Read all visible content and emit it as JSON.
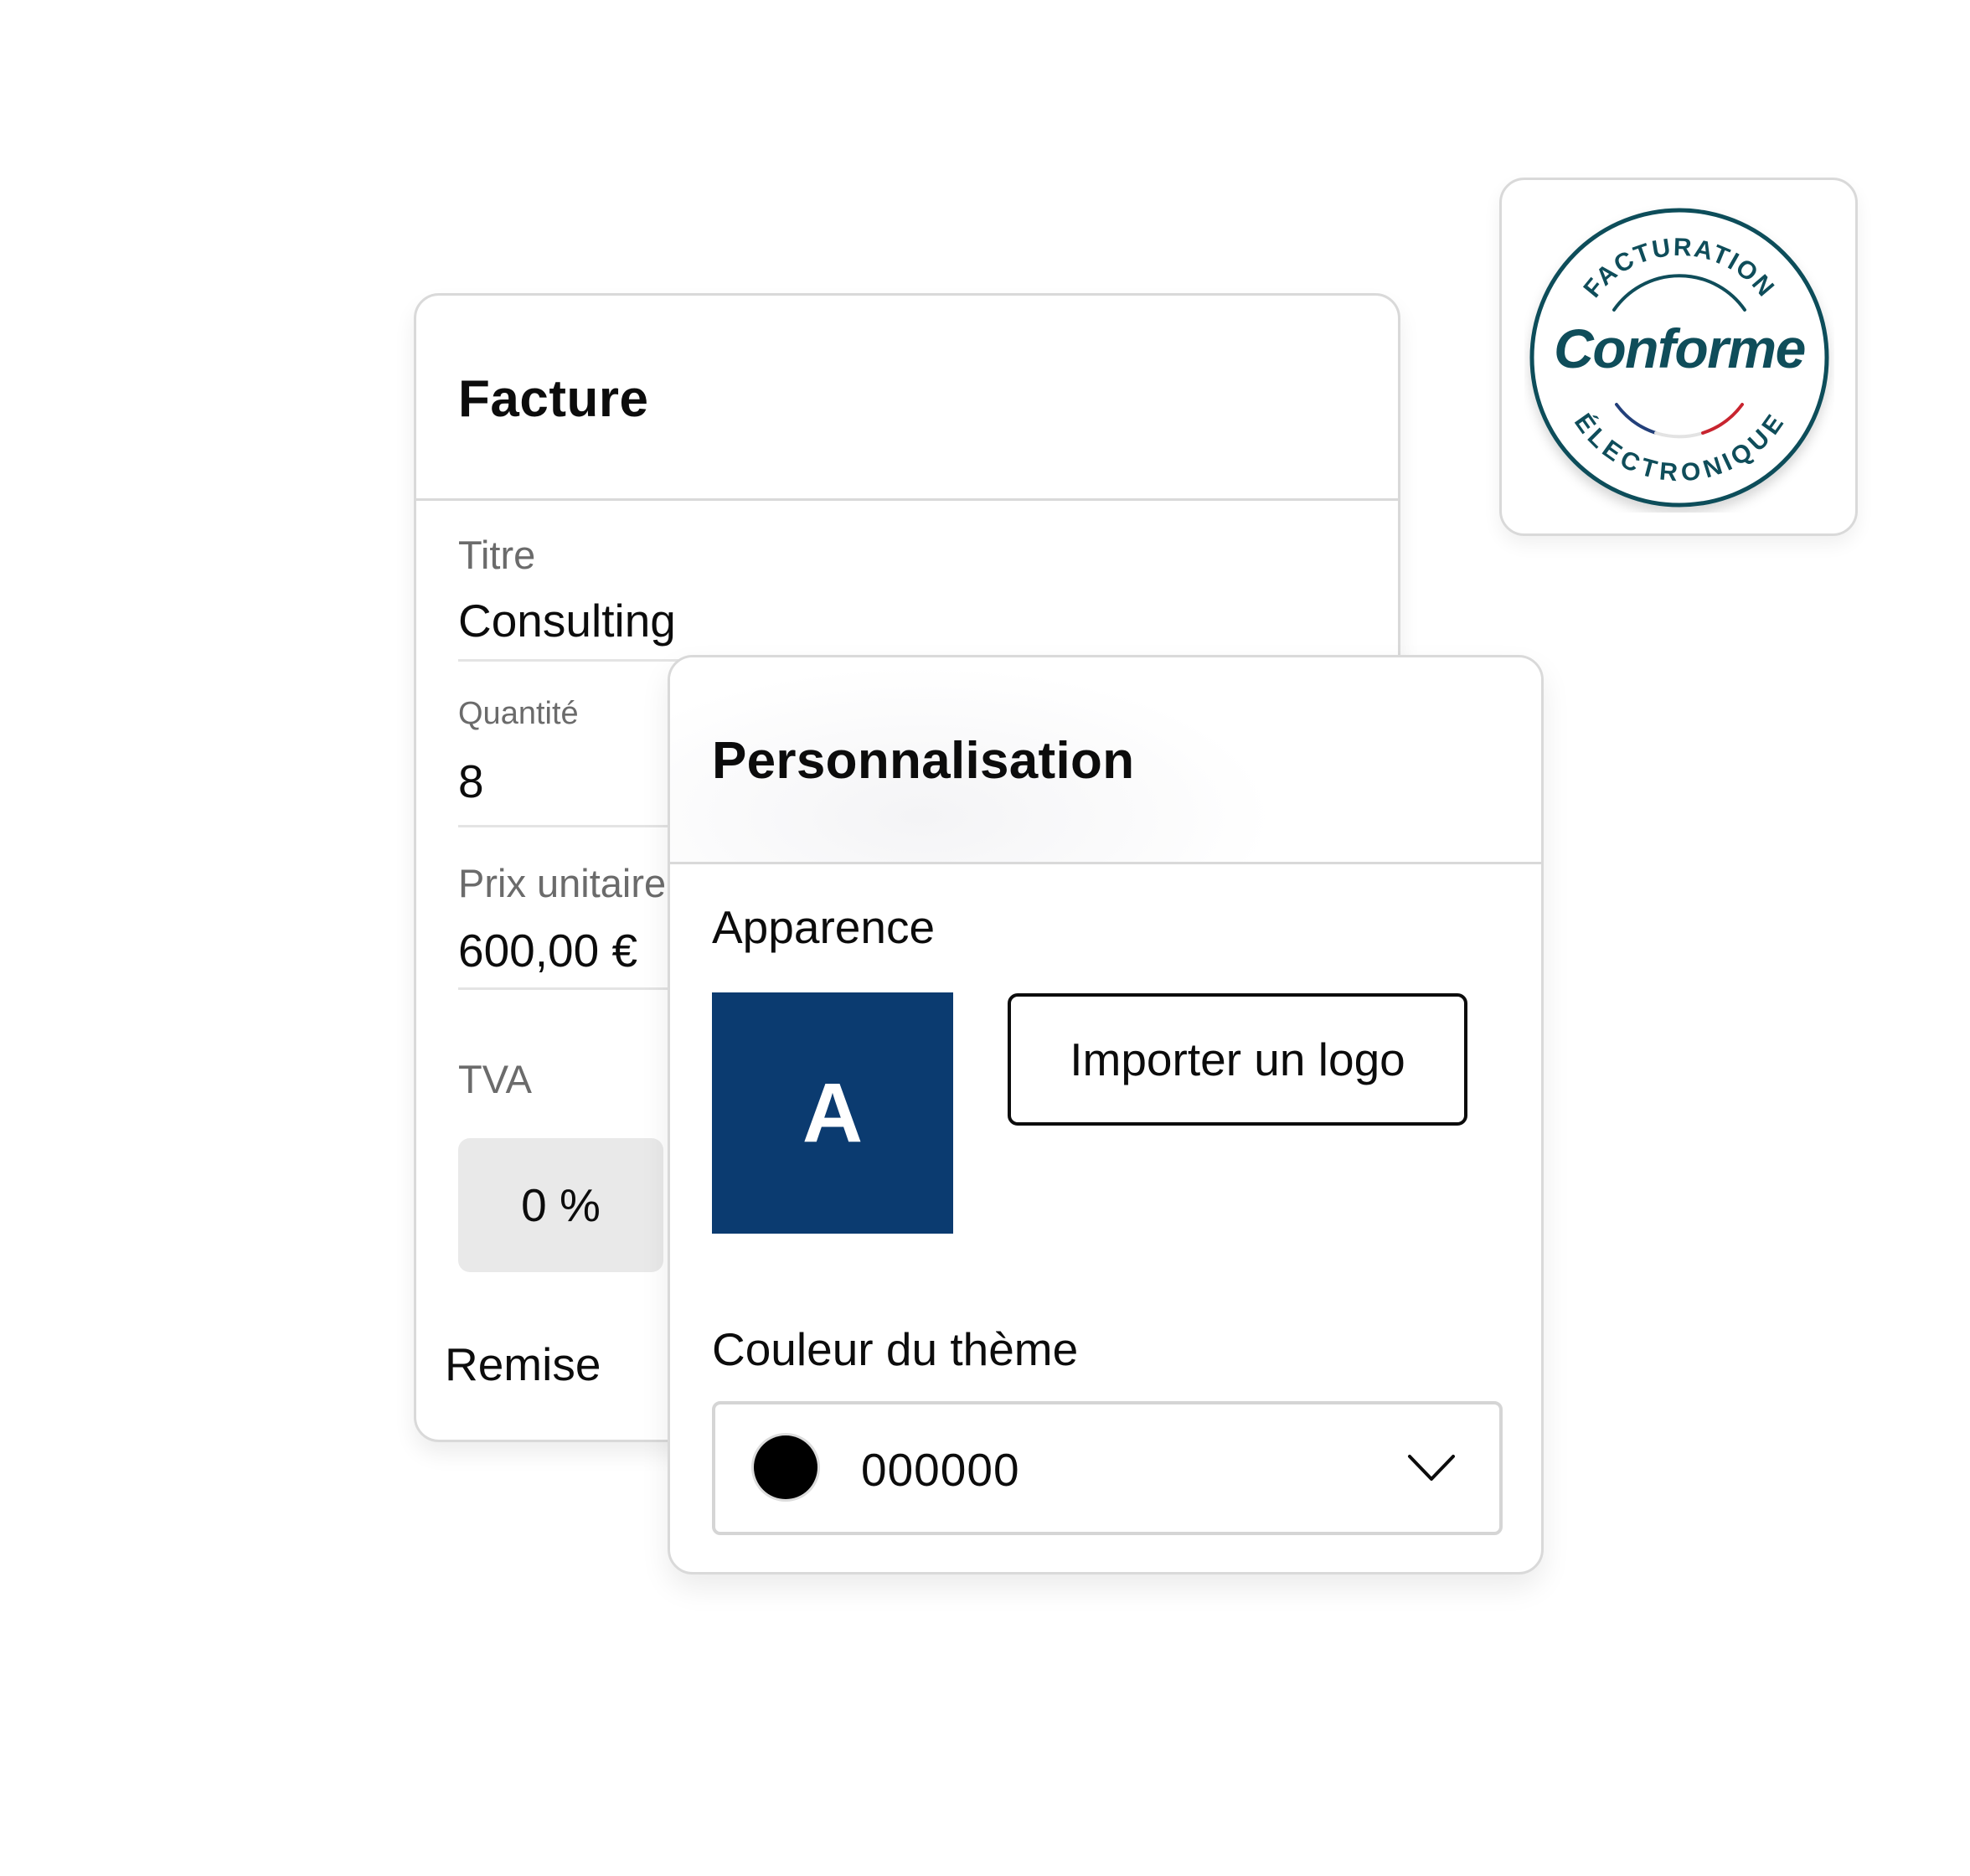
{
  "invoice": {
    "title": "Facture",
    "fields": [
      {
        "label": "Titre",
        "value": "Consulting"
      },
      {
        "label": "Quantité",
        "value": "8"
      },
      {
        "label": "Prix unitaire",
        "value": "600,00 €"
      }
    ],
    "vat": {
      "label": "TVA",
      "value": "0 %"
    },
    "discount_label": "Remise"
  },
  "customization": {
    "title": "Personnalisation",
    "appearance_label": "Apparence",
    "logo_letter": "A",
    "import_logo_label": "Importer un logo",
    "theme_color_label": "Couleur du thème",
    "theme_color_value": "000000",
    "theme_color_swatch": "#000000",
    "select_icon": "chevron-down-icon"
  },
  "badge": {
    "top_text": "FACTURATION",
    "main_text": "Conforme",
    "bottom_text": "ÉLECTRONIQUE",
    "colors": {
      "primary": "#0f4d5a",
      "blue": "#23407a",
      "red": "#c8242f"
    }
  },
  "colors": {
    "logo_tile": "#0b3b70",
    "card_border": "#d9d9d9",
    "vat_chip": "#e9e9e9"
  }
}
